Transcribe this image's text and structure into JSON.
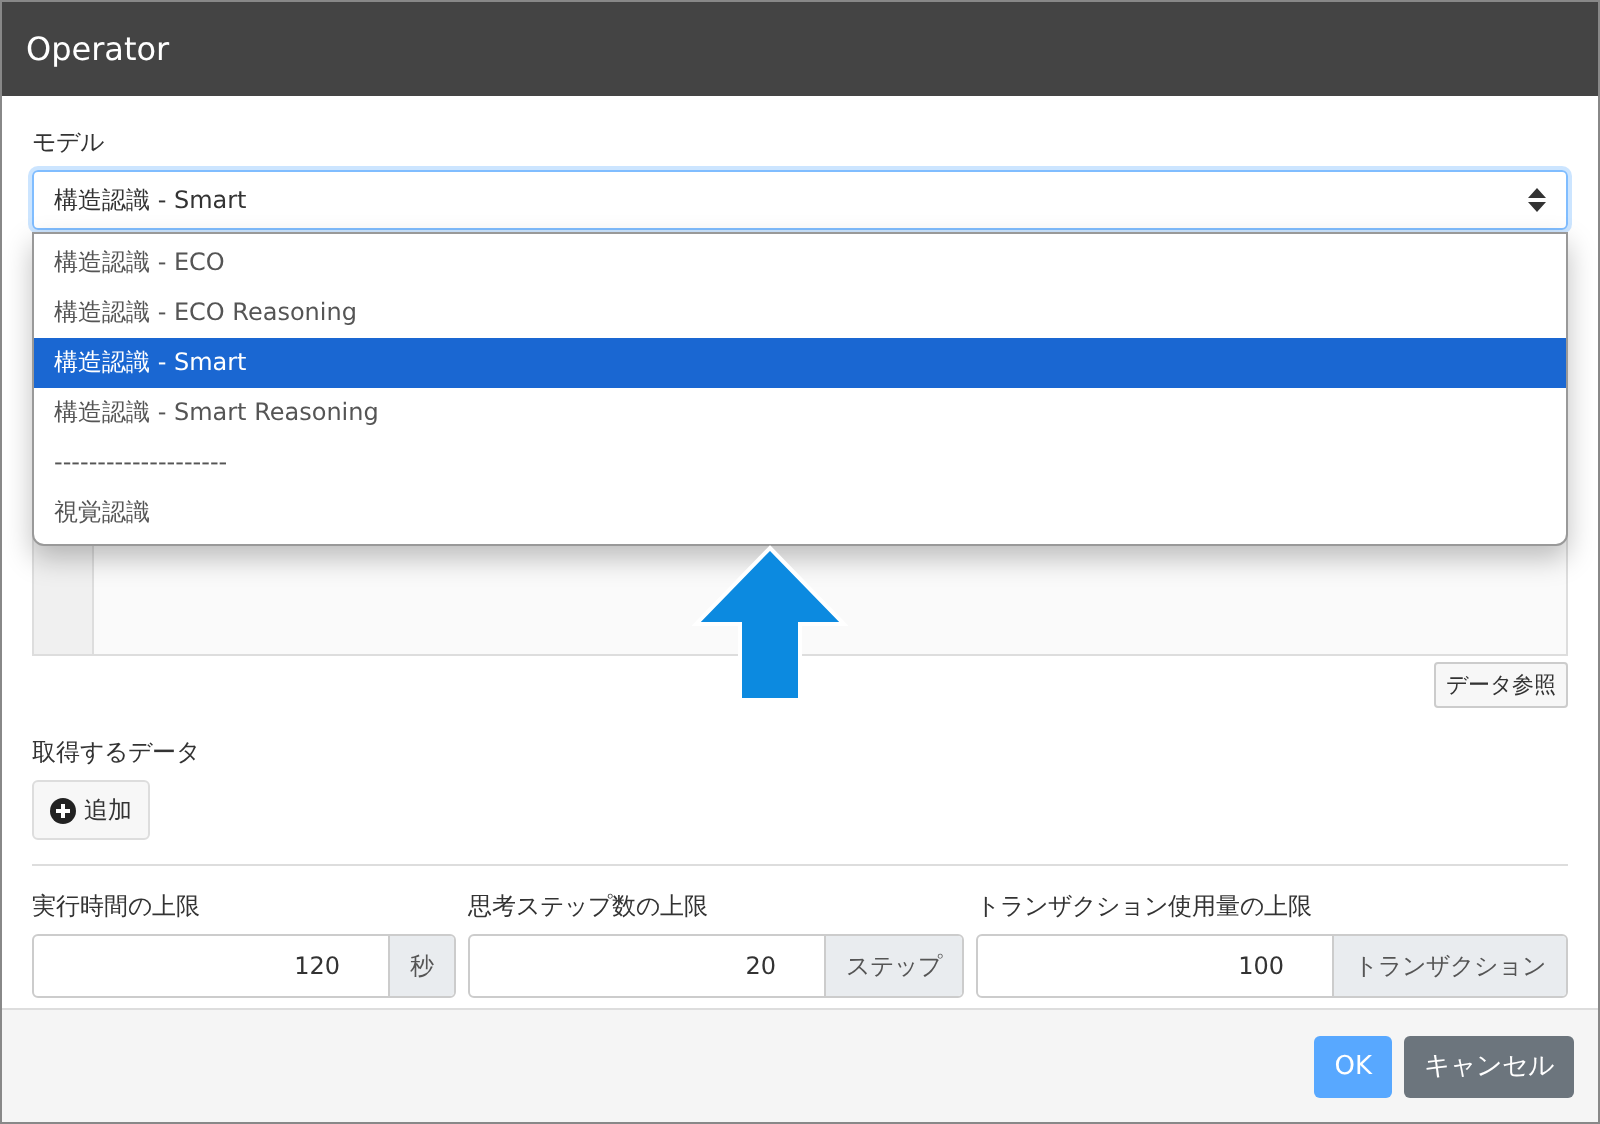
{
  "window": {
    "title": "Operator"
  },
  "model": {
    "label": "モデル",
    "value": "構造認識 - Smart",
    "options": [
      {
        "label": "構造認識 - ECO",
        "selected": false
      },
      {
        "label": "構造認識 - ECO Reasoning",
        "selected": false
      },
      {
        "label": "構造認識 - Smart",
        "selected": true
      },
      {
        "label": "構造認識 - Smart Reasoning",
        "selected": false
      },
      {
        "label": "--------------------",
        "selected": false
      },
      {
        "label": "視覚認識",
        "selected": false
      }
    ]
  },
  "data_ref_button": "データ参照",
  "fetch_data": {
    "label": "取得するデータ",
    "add_button": "追加"
  },
  "limits": [
    {
      "label": "実行時間の上限",
      "value": "120",
      "unit": "秒"
    },
    {
      "label": "思考ステップ数の上限",
      "value": "20",
      "unit": "ステップ"
    },
    {
      "label": "トランザクション使用量の上限",
      "value": "100",
      "unit": "トランザクション"
    }
  ],
  "buttons": [
    {
      "label": "OK",
      "kind": "primary"
    },
    {
      "label": "キャンセル",
      "kind": "secondary"
    }
  ]
}
